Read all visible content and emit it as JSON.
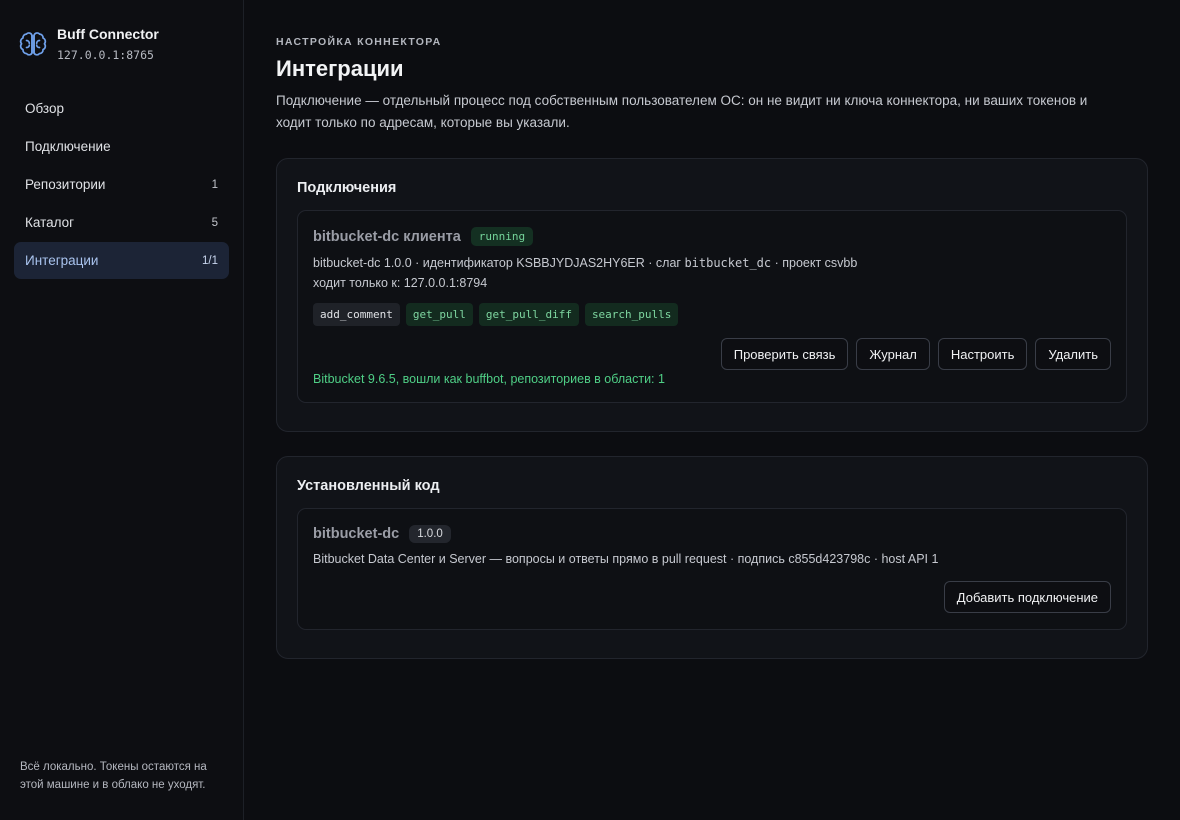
{
  "brand": {
    "name": "Buff Connector",
    "host": "127.0.0.1:8765"
  },
  "nav": [
    {
      "label": "Обзор",
      "count": ""
    },
    {
      "label": "Подключение",
      "count": ""
    },
    {
      "label": "Репозитории",
      "count": "1"
    },
    {
      "label": "Каталог",
      "count": "5"
    },
    {
      "label": "Интеграции",
      "count": "1/1",
      "active": true
    }
  ],
  "sidebar_footer": "Всё локально. Токены остаются на этой машине и в облако не уходят.",
  "header": {
    "eyebrow": "НАСТРОЙКА КОННЕКТОРА",
    "title": "Интеграции",
    "description": "Подключение — отдельный процесс под собственным пользователем ОС: он не видит ни ключа коннектора, ни ваших токенов и ходит только по адресам, которые вы указали."
  },
  "connections": {
    "title": "Подключения",
    "item": {
      "name": "bitbucket-dc клиента",
      "status": "running",
      "meta_prefix": "bitbucket-dc 1.0.0 · идентификатор KSBBJYDJAS2HY6ER · слаг ",
      "slug": "bitbucket_dc",
      "meta_suffix": " · проект csvbb",
      "hosts": "ходит только к: 127.0.0.1:8794",
      "tools": [
        "add_comment",
        "get_pull",
        "get_pull_diff",
        "search_pulls"
      ],
      "buttons": {
        "check": "Проверить связь",
        "log": "Журнал",
        "configure": "Настроить",
        "delete": "Удалить"
      },
      "check_result": "Bitbucket 9.6.5, вошли как buffbot, репозиториев в области: 1"
    }
  },
  "installed": {
    "title": "Установленный код",
    "item": {
      "name": "bitbucket-dc",
      "version": "1.0.0",
      "description": "Bitbucket Data Center и Server — вопросы и ответы прямо в pull request · подпись c855d423798c · host API 1",
      "add_button": "Добавить подключение"
    }
  },
  "colors": {
    "accent": "#6fa0ea",
    "running": "#74d49a",
    "ok": "#4fcf86"
  }
}
